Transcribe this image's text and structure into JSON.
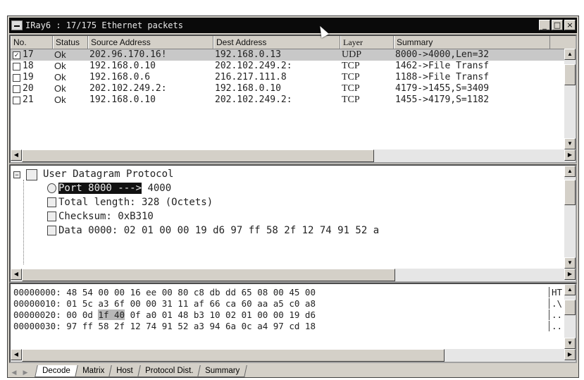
{
  "window": {
    "title": "IRay6 : 17/175 Ethernet packets",
    "controls": [
      "_",
      "□",
      "×"
    ]
  },
  "packet_list": {
    "columns": [
      "No.",
      "Status",
      "Source Address",
      "Dest Address",
      "Layer",
      "Summary"
    ],
    "rows": [
      {
        "no": "17",
        "checked": true,
        "status": "Ok",
        "src": "202.96.170.16!",
        "dst": "192.168.0.13",
        "layer": "UDP",
        "summary": "8000->4000,Len=32"
      },
      {
        "no": "18",
        "checked": false,
        "status": "Ok",
        "src": "192.168.0.10",
        "dst": "202.102.249.2:",
        "layer": "TCP",
        "summary": "1462->File Transf"
      },
      {
        "no": "19",
        "checked": false,
        "status": "Ok",
        "src": "192.168.0.6",
        "dst": "216.217.111.8",
        "layer": "TCP",
        "summary": "1188->File Transf"
      },
      {
        "no": "20",
        "checked": false,
        "status": "Ok",
        "src": "202.102.249.2:",
        "dst": "192.168.0.10",
        "layer": "TCP",
        "summary": "4179->1455,S=3409"
      },
      {
        "no": "21",
        "checked": false,
        "status": "Ok",
        "src": "192.168.0.10",
        "dst": "202.102.249.2:",
        "layer": "TCP",
        "summary": "1455->4179,S=1182"
      }
    ]
  },
  "decode": {
    "root": "User Datagram Protocol",
    "port_selected": "Port 8000 --->",
    "port_rest": "4000",
    "total_length": "Total length: 328 (Octets)",
    "checksum": "Checksum: 0xB310",
    "data": "Data 0000: 02 01 00 00 19 d6 97 ff 58 2f 12 74 91 52 a"
  },
  "hex": {
    "lines": [
      {
        "offset": "00000000:",
        "pre": "48 54 00 00 16 ee 00 80 c8 db dd 65 08 00 45 00",
        "hl": "",
        "post": "",
        "ascii": "HT"
      },
      {
        "offset": "00000010:",
        "pre": "01 5c a3 6f 00 00 31 11 af 66 ca 60 aa a5 c0 a8",
        "hl": "",
        "post": "",
        "ascii": ".\\"
      },
      {
        "offset": "00000020:",
        "pre": "00 0d ",
        "hl": "1f 40",
        "post": " 0f a0 01 48 b3 10 02 01 00 00 19 d6",
        "ascii": ".."
      },
      {
        "offset": "00000030:",
        "pre": "97 ff 58 2f 12 74 91 52 a3 94 6a 0c a4 97 cd 18",
        "hl": "",
        "post": "",
        "ascii": ".."
      }
    ]
  },
  "tabs": [
    "Decode",
    "Matrix",
    "Host",
    "Protocol Dist.",
    "Summary"
  ],
  "active_tab": "Decode"
}
